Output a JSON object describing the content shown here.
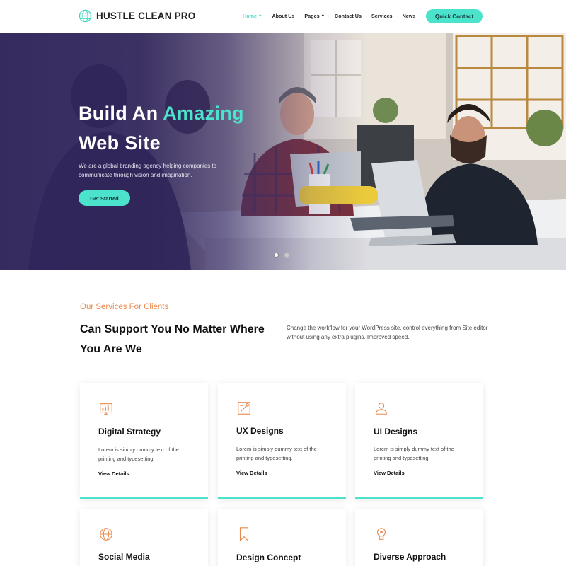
{
  "header": {
    "logo_text": "HUSTLE CLEAN PRO",
    "nav": [
      {
        "label": "Home",
        "has_dropdown": true,
        "active": true
      },
      {
        "label": "About Us",
        "has_dropdown": false
      },
      {
        "label": "Pages",
        "has_dropdown": true
      },
      {
        "label": "Contact Us",
        "has_dropdown": false
      },
      {
        "label": "Services",
        "has_dropdown": false
      },
      {
        "label": "News",
        "has_dropdown": false
      }
    ],
    "cta_label": "Quick Contact"
  },
  "hero": {
    "title_part1": "Build An ",
    "title_accent": "Amazing",
    "title_line2": "Web Site",
    "description": "We are a global branding agency helping companies to communicate through vision and imagination.",
    "button_label": "Get Started",
    "slides_total": 2,
    "active_slide": 1
  },
  "services": {
    "kicker": "Our Services For Clients",
    "heading": "Can Support You No Matter Where You Are We",
    "description": "Change the workflow for your WordPress site, control everything from Site editor without using any extra plugins. Improved speed.",
    "cards": [
      {
        "title": "Digital Strategy",
        "text": "Lorem is simply dummy text of the printing and typesetting.",
        "link": "View Details",
        "icon": "chart-monitor-icon"
      },
      {
        "title": "UX Designs",
        "text": "Lorem is simply dummy text of the printing and typesetting.",
        "link": "View Details",
        "icon": "design-pen-icon"
      },
      {
        "title": "UI Designs",
        "text": "Lorem is simply dummy text of the printing and typesetting.",
        "link": "View Details",
        "icon": "designer-person-icon"
      },
      {
        "title": "Social Media",
        "icon": "globe-icon"
      },
      {
        "title": "Design Concept",
        "icon": "bookmark-icon"
      },
      {
        "title": "Diverse Approach",
        "icon": "idea-approach-icon"
      }
    ]
  },
  "colors": {
    "accent": "#4be3cb",
    "hero_overlay": "#31265c",
    "kicker": "#e88a4e",
    "icon": "#e88a4e"
  }
}
